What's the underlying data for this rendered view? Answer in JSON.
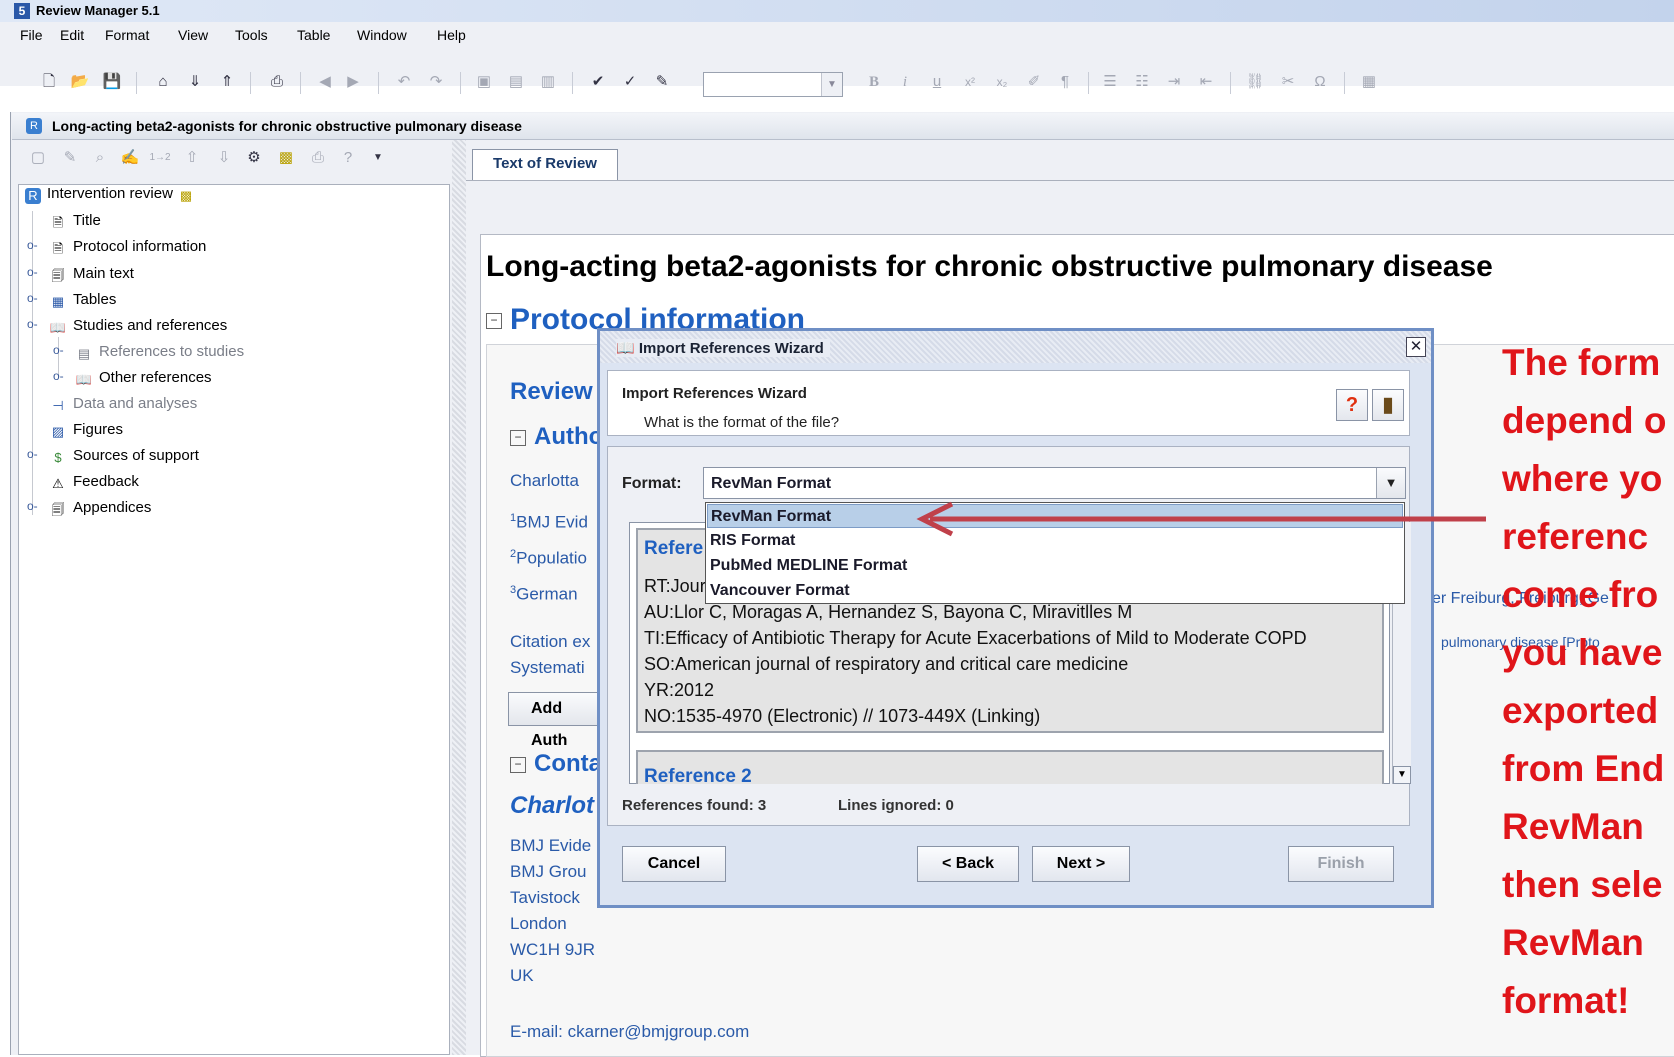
{
  "app": {
    "title": "Review Manager 5.1"
  },
  "menubar": [
    "File",
    "Edit",
    "Format",
    "View",
    "Tools",
    "Table",
    "Window",
    "Help"
  ],
  "document_window": {
    "title": "Long-acting beta2-agonists for chronic obstructive pulmonary disease"
  },
  "tree": {
    "root": "Intervention review",
    "items": [
      {
        "label": "Title",
        "icon": "page-icon"
      },
      {
        "label": "Protocol information",
        "icon": "page-icon"
      },
      {
        "label": "Main text",
        "icon": "pages-icon"
      },
      {
        "label": "Tables",
        "icon": "table-icon"
      },
      {
        "label": "Studies and references",
        "icon": "book-icon"
      },
      {
        "label": "References to studies",
        "icon": "studies-icon",
        "dim": true
      },
      {
        "label": "Other references",
        "icon": "book-icon"
      },
      {
        "label": "Data and analyses",
        "icon": "analyses-icon",
        "dim": true
      },
      {
        "label": "Figures",
        "icon": "figure-icon"
      },
      {
        "label": "Sources of support",
        "icon": "support-icon"
      },
      {
        "label": "Feedback",
        "icon": "feedback-icon"
      },
      {
        "label": "Appendices",
        "icon": "pages-icon"
      }
    ]
  },
  "tab": {
    "label": "Text of Review"
  },
  "document": {
    "heading": "Long-acting beta2-agonists for chronic obstructive pulmonary disease",
    "protocol_heading": "Protocol information",
    "review_label": "Review",
    "authors_heading": "Autho",
    "author_name": "Charlotta",
    "affil1_sup": "1",
    "affil1": "BMJ Evid",
    "affil2_sup": "2",
    "affil2": "Populatio",
    "affil3_sup": "3",
    "affil3": "German",
    "affil3_right": "er Freiburg, Freiburg, Ge",
    "citation1": "Citation ex",
    "citation2": "Systemati",
    "citation_right": "pulmonary disease [Proto",
    "add_author_button": "Add Auth",
    "contact_heading": "Conta",
    "contact_name": "Charlot",
    "address": [
      "BMJ Evide",
      "BMJ Grou",
      "Tavistock",
      "London",
      "WC1H 9JR",
      "UK"
    ],
    "email": "E-mail: ckarner@bmjgroup.com"
  },
  "dialog": {
    "title": "Import References Wizard",
    "header_title": "Import References Wizard",
    "header_subtitle": "What is the format of the file?",
    "format_label": "Format:",
    "format_value": "RevMan Format",
    "format_options": [
      "RevMan Format",
      "RIS Format",
      "PubMed MEDLINE Format",
      "Vancouver Format"
    ],
    "reference1_title": "Refere",
    "reference1_lines": [
      "RT:Jour",
      "AU:Llor C, Moragas A, Hernandez S, Bayona C, Miravitlles M",
      "TI:Efficacy of Antibiotic Therapy for Acute Exacerbations of Mild to Moderate COPD",
      "SO:American journal of respiratory and critical care medicine",
      "YR:2012",
      "NO:1535-4970 (Electronic) // 1073-449X (Linking)"
    ],
    "reference2_title": "Reference 2",
    "refs_found": "References found: 3",
    "lines_ignored": "Lines ignored: 0",
    "buttons": {
      "cancel": "Cancel",
      "back": "< Back",
      "next": "Next >",
      "finish": "Finish"
    }
  },
  "annotation": {
    "color": "#e0151a",
    "lines": [
      "The form",
      "depend o",
      "where yo",
      "referenc",
      "come fro",
      "you have",
      "exported",
      "from End",
      "RevMan",
      "then sele",
      "RevMan",
      "format!"
    ]
  }
}
